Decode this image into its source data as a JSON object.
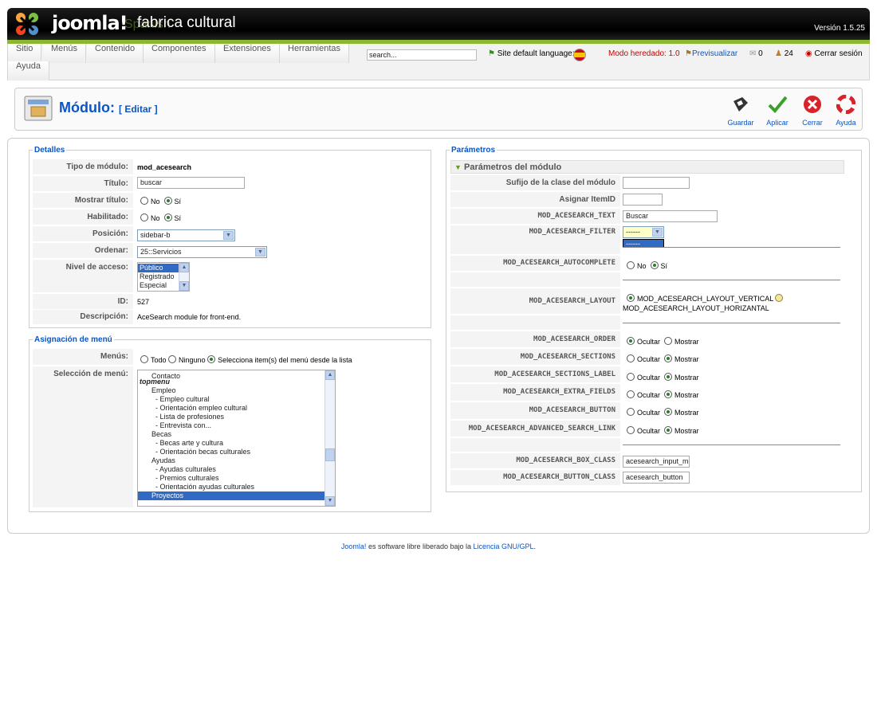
{
  "header": {
    "brand": "joomla!",
    "brand_faded": "Spanish",
    "site_name": "fabrica cultural",
    "version": "Versión 1.5.25"
  },
  "menu": {
    "items": [
      "Sitio",
      "Menús",
      "Contenido",
      "Componentes",
      "Extensiones",
      "Herramientas",
      "Ayuda"
    ],
    "search_value": "search...",
    "site_language": "Site default language:",
    "legacy_mode": "Modo heredado: 1.0",
    "preview": "Previsualizar",
    "messages_count": "0",
    "users_count": "24",
    "logout": "Cerrar sesión"
  },
  "titlebar": {
    "title": "Módulo:",
    "subtitle": "[ Editar ]",
    "toolbar": {
      "save": "Guardar",
      "apply": "Aplicar",
      "cancel": "Cerrar",
      "help": "Ayuda"
    }
  },
  "details": {
    "legend": "Detalles",
    "module_type_label": "Tipo de módulo:",
    "module_type": "mod_acesearch",
    "title_label": "Título:",
    "title": "buscar",
    "show_title_label": "Mostrar título:",
    "enabled_label": "Habilitado:",
    "no": "No",
    "yes": "Sí",
    "position_label": "Posición:",
    "position": "sidebar-b",
    "order_label": "Ordenar:",
    "order": "25::Servicios",
    "access_label": "Nivel de acceso:",
    "access_options": [
      "Público",
      "Registrado",
      "Especial"
    ],
    "id_label": "ID:",
    "id": "527",
    "description_label": "Descripción:",
    "description": "AceSearch module for front-end."
  },
  "menu_assignment": {
    "legend": "Asignación de menú",
    "menus_label": "Menús:",
    "all": "Todo",
    "none": "Ninguno",
    "select": "Selecciona item(s) del menú desde la lista",
    "selection_label": "Selección de menú:",
    "items": [
      "Contacto",
      "topmenu",
      "Empleo",
      "- Empleo cultural",
      "- Orientación empleo cultural",
      "- Lista de profesiones",
      "- Entrevista con...",
      "Becas",
      "- Becas arte y cultura",
      "- Orientación becas culturales",
      "Ayudas",
      "- Ayudas culturales",
      "- Premios culturales",
      "- Orientación ayudas culturales",
      "Proyectos"
    ]
  },
  "params": {
    "legend": "Parámetros",
    "section": "Parámetros del módulo",
    "suffix_label": "Sufijo de la clase del módulo",
    "itemid_label": "Asignar ItemID",
    "text_label": "MOD_ACESEARCH_TEXT",
    "text_value": "Buscar",
    "filter_label": "MOD_ACESEARCH_FILTER",
    "filter_value": "------",
    "filter_option": "------",
    "autocomplete_label": "MOD_ACESEARCH_AUTOCOMPLETE",
    "no": "No",
    "yes": "Sí",
    "layout_label": "MOD_ACESEARCH_LAYOUT",
    "layout_vertical": "MOD_ACESEARCH_LAYOUT_VERTICAL",
    "layout_horizontal": "MOD_ACESEARCH_LAYOUT_HORIZANTAL",
    "hide": "Ocultar",
    "show": "Mostrar",
    "order_label": "MOD_ACESEARCH_ORDER",
    "sections_label": "MOD_ACESEARCH_SECTIONS",
    "sections_label_label": "MOD_ACESEARCH_SECTIONS_LABEL",
    "extra_fields_label": "MOD_ACESEARCH_EXTRA_FIELDS",
    "button_label": "MOD_ACESEARCH_BUTTON",
    "advanced_link_label": "MOD_ACESEARCH_ADVANCED_SEARCH_LINK",
    "box_class_label": "MOD_ACESEARCH_BOX_CLASS",
    "box_class_value": "acesearch_input_mo",
    "button_class_label": "MOD_ACESEARCH_BUTTON_CLASS",
    "button_class_value": "acesearch_button"
  },
  "footer": {
    "joomla": "Joomla!",
    "text": " es software libre liberado bajo la ",
    "license": "Licencia GNU/GPL",
    "end": "."
  },
  "colors": {
    "link": "#0b55c4",
    "green": "#8ab930",
    "header": "#000000"
  }
}
